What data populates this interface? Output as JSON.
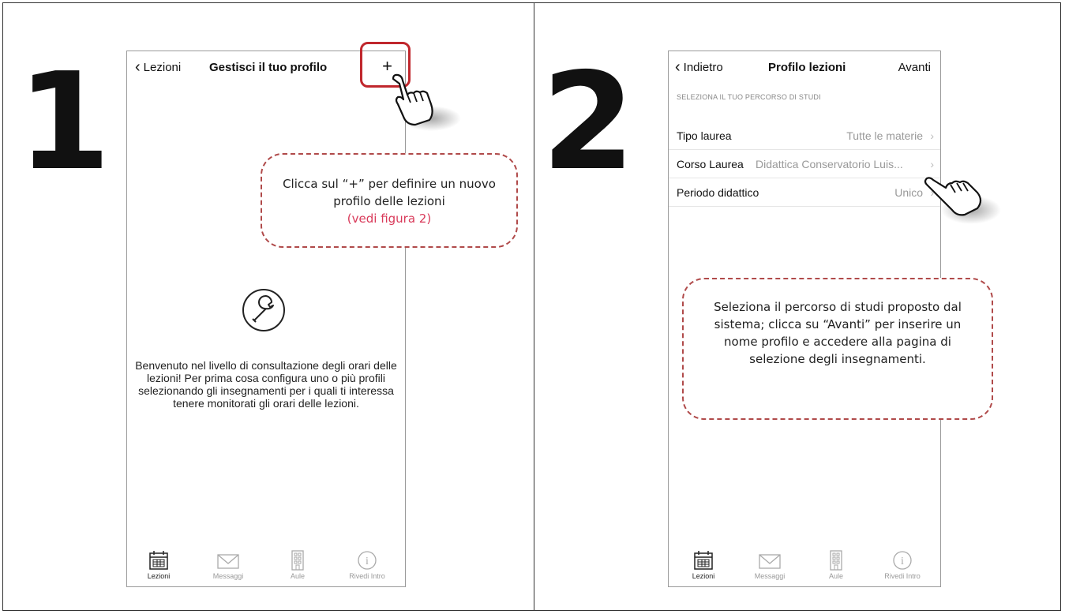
{
  "step1": {
    "number": "1",
    "nav": {
      "back_label": "Lezioni",
      "title": "Gestisci il tuo profilo",
      "action_label": "+"
    },
    "welcome_text": "Benvenuto nel livello di consultazione degli orari delle lezioni! Per prima cosa configura uno o più profili selezionando gli insegnamenti per i quali ti interessa tenere monitorati gli orari delle lezioni.",
    "callout": {
      "text": "Clicca sul “+” per definire un nuovo profilo delle lezioni",
      "link": "(vedi figura 2)"
    },
    "tabs": [
      {
        "label": "Lezioni",
        "icon": "calendar-icon",
        "active": true
      },
      {
        "label": "Messaggi",
        "icon": "envelope-icon",
        "active": false
      },
      {
        "label": "Aule",
        "icon": "building-icon",
        "active": false
      },
      {
        "label": "Rivedi Intro",
        "icon": "info-icon",
        "active": false
      }
    ],
    "highlight_color": "#c0272d"
  },
  "step2": {
    "number": "2",
    "nav": {
      "back_label": "Indietro",
      "title": "Profilo lezioni",
      "action_label": "Avanti"
    },
    "section_header": "SELEZIONA IL TUO PERCORSO DI STUDI",
    "rows": [
      {
        "label": "Tipo laurea",
        "value": "Tutte le materie"
      },
      {
        "label": "Corso Laurea",
        "value": "Didattica Conservatorio Luis..."
      },
      {
        "label": "Periodo didattico",
        "value": "Unico"
      }
    ],
    "callout": {
      "text": "Seleziona il percorso di studi proposto dal sistema; clicca su “Avanti” per inserire un nome profilo e accedere alla pagina di selezione degli insegnamenti."
    },
    "tabs": [
      {
        "label": "Lezioni",
        "icon": "calendar-icon",
        "active": true
      },
      {
        "label": "Messaggi",
        "icon": "envelope-icon",
        "active": false
      },
      {
        "label": "Aule",
        "icon": "building-icon",
        "active": false
      },
      {
        "label": "Rivedi Intro",
        "icon": "info-icon",
        "active": false
      }
    ]
  },
  "colors": {
    "callout_border": "#b04a4a",
    "link": "#d93a5a",
    "highlight": "#c0272d"
  }
}
